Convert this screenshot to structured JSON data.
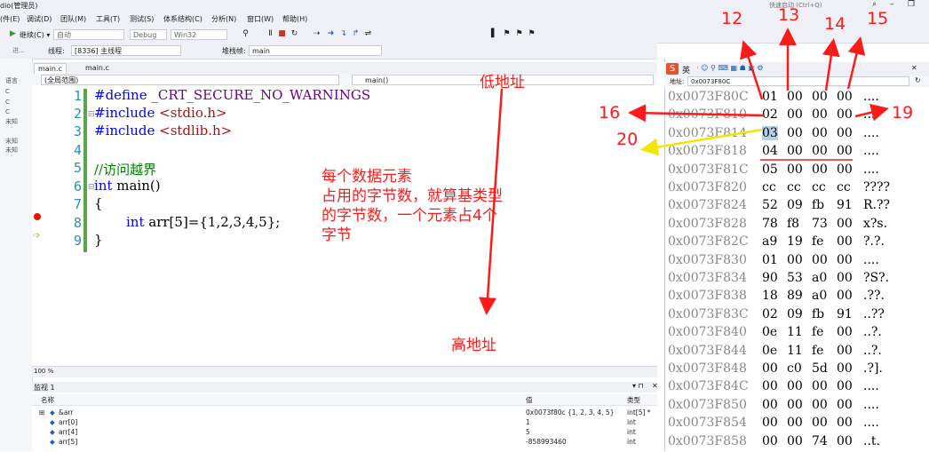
{
  "window": {
    "title": "dio(管理员)",
    "quick_launch": "快速启动 (Ctrl+Q)"
  },
  "menu": [
    "调试(D)",
    "团队(M)",
    "工具(T)",
    "测试(S)",
    "体系结构(C)",
    "分析(N)",
    "窗口(W)",
    "帮助(H)"
  ],
  "menu_lead": "(件(E)",
  "toolbar": {
    "continue": "继续(C) ▾",
    "auto": "自动",
    "config": "Debug",
    "platform": "Win32"
  },
  "toolbar2": {
    "process_label": "进...",
    "thread_label": "线程:",
    "thread_value": "[8336] 主线程",
    "stack_label": "堆栈帧:",
    "stack_value": "main"
  },
  "leftpane": [
    "语言",
    "C",
    "C",
    "C",
    "未知",
    "",
    "未知",
    "未知"
  ],
  "tabs": {
    "active": "main.c",
    "other": "main.c"
  },
  "nav": {
    "scope": "(全局范围)",
    "func": "main()"
  },
  "code": {
    "lines": [
      "1",
      "2",
      "3",
      "4",
      "5",
      "6",
      "7",
      "8",
      "9"
    ],
    "l1_kw": "#define",
    "l1_rest": " _CRT_SECURE_NO_WARNINGS",
    "l2_kw": "#include",
    "l2_str": " <stdio.h>",
    "l3_kw": "#include",
    "l3_str": " <stdlib.h>",
    "l5": "//访问越界",
    "l6_kw": "int",
    "l6_rest": " main()",
    "l7": "{",
    "l8_kw": "int",
    "l8_rest": " arr[5]={1,2,3,4,5};",
    "l9": "}"
  },
  "zoom": "100 %",
  "watch": {
    "title": "监视 1",
    "headers": [
      "名称",
      "值",
      "类型"
    ],
    "rows": [
      {
        "name": "&arr",
        "value": "0x0073f80c {1, 2, 3, 4, 5}",
        "type": "int[5] *"
      },
      {
        "name": "arr[0]",
        "value": "1",
        "type": "int"
      },
      {
        "name": "arr[4]",
        "value": "5",
        "type": "int"
      },
      {
        "name": "arr[5]",
        "value": "-858993460",
        "type": "int"
      }
    ]
  },
  "memory": {
    "addr_label": "地址:",
    "addr_value": "0x0073F80C",
    "ime_label": "英",
    "rows": [
      {
        "a": "0x0073F80C",
        "b": [
          "01",
          "00",
          "00",
          "00"
        ],
        "s": "...."
      },
      {
        "a": "0x0073F810",
        "b": [
          "02",
          "00",
          "00",
          "00"
        ],
        "s": "...."
      },
      {
        "a": "0x0073F814",
        "b": [
          "03",
          "00",
          "00",
          "00"
        ],
        "s": "...."
      },
      {
        "a": "0x0073F818",
        "b": [
          "04",
          "00",
          "00",
          "00"
        ],
        "s": "...."
      },
      {
        "a": "0x0073F81C",
        "b": [
          "05",
          "00",
          "00",
          "00"
        ],
        "s": "...."
      },
      {
        "a": "0x0073F820",
        "b": [
          "cc",
          "cc",
          "cc",
          "cc"
        ],
        "s": "????"
      },
      {
        "a": "0x0073F824",
        "b": [
          "52",
          "09",
          "fb",
          "91"
        ],
        "s": "R.??"
      },
      {
        "a": "0x0073F828",
        "b": [
          "78",
          "f8",
          "73",
          "00"
        ],
        "s": "x?s."
      },
      {
        "a": "0x0073F82C",
        "b": [
          "a9",
          "19",
          "fe",
          "00"
        ],
        "s": "?.?."
      },
      {
        "a": "0x0073F830",
        "b": [
          "01",
          "00",
          "00",
          "00"
        ],
        "s": "...."
      },
      {
        "a": "0x0073F834",
        "b": [
          "90",
          "53",
          "a0",
          "00"
        ],
        "s": "?S?."
      },
      {
        "a": "0x0073F838",
        "b": [
          "18",
          "89",
          "a0",
          "00"
        ],
        "s": ".??."
      },
      {
        "a": "0x0073F83C",
        "b": [
          "02",
          "09",
          "fb",
          "91"
        ],
        "s": "..??"
      },
      {
        "a": "0x0073F840",
        "b": [
          "0e",
          "11",
          "fe",
          "00"
        ],
        "s": "..?."
      },
      {
        "a": "0x0073F844",
        "b": [
          "0e",
          "11",
          "fe",
          "00"
        ],
        "s": "..?."
      },
      {
        "a": "0x0073F848",
        "b": [
          "00",
          "c0",
          "5d",
          "00"
        ],
        "s": ".?]."
      },
      {
        "a": "0x0073F84C",
        "b": [
          "00",
          "00",
          "00",
          "00"
        ],
        "s": "...."
      },
      {
        "a": "0x0073F850",
        "b": [
          "00",
          "00",
          "00",
          "00"
        ],
        "s": "...."
      },
      {
        "a": "0x0073F854",
        "b": [
          "00",
          "00",
          "00",
          "00"
        ],
        "s": "...."
      },
      {
        "a": "0x0073F858",
        "b": [
          "00",
          "00",
          "74",
          "00"
        ],
        "s": "..t."
      }
    ]
  },
  "annotations": {
    "low_addr": "低地址",
    "high_addr": "高地址",
    "note_l1": "每个数据元素",
    "note_l2": "占用的字节数，就算基类型",
    "note_l3": "的字节数，一个元素占4个",
    "note_l4": "字节",
    "n12": "12",
    "n13": "13",
    "n14": "14",
    "n15": "15",
    "n16": "16",
    "n19": "19",
    "n20": "20"
  },
  "colors": {
    "annotation": "#ff1a1a",
    "yellow_arrow": "#f2e600",
    "keyword": "#0000ff",
    "string": "#a31515",
    "comment": "#008000",
    "selection": "#b7cfea"
  }
}
